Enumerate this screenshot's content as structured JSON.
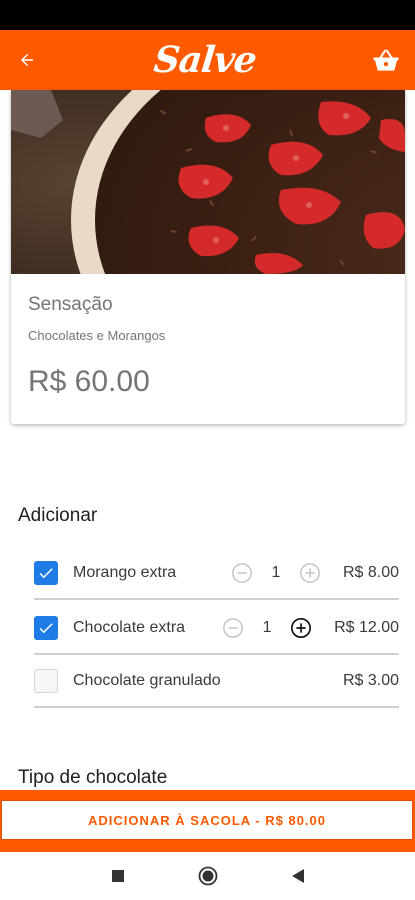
{
  "app": {
    "logo_text": "Salve",
    "brand_color": "#ff5a00",
    "icons": {
      "back": "arrow-left-icon",
      "cart": "shopping-basket-icon"
    }
  },
  "product": {
    "name": "Sensação",
    "description": "Chocolates e Morangos",
    "price": "R$ 60.00"
  },
  "addons": {
    "title": "Adicionar",
    "items": [
      {
        "name": "Morango extra",
        "checked": true,
        "quantity": "1",
        "price": "R$ 8.00"
      },
      {
        "name": "Chocolate extra",
        "checked": true,
        "quantity": "1",
        "price": "R$ 12.00"
      },
      {
        "name": "Chocolate granulado",
        "checked": false,
        "quantity": "",
        "price": "R$ 3.00"
      }
    ]
  },
  "chocolate_type": {
    "title": "Tipo de chocolate"
  },
  "footer": {
    "cta_label": "ADICIONAR À SACOLA - R$ 80.00"
  },
  "system_nav": {
    "icons": [
      "square-recents-icon",
      "circle-home-icon",
      "triangle-back-icon"
    ]
  },
  "colors": {
    "checkbox_checked": "#1f7be6",
    "divider": "#cfcfcf"
  }
}
